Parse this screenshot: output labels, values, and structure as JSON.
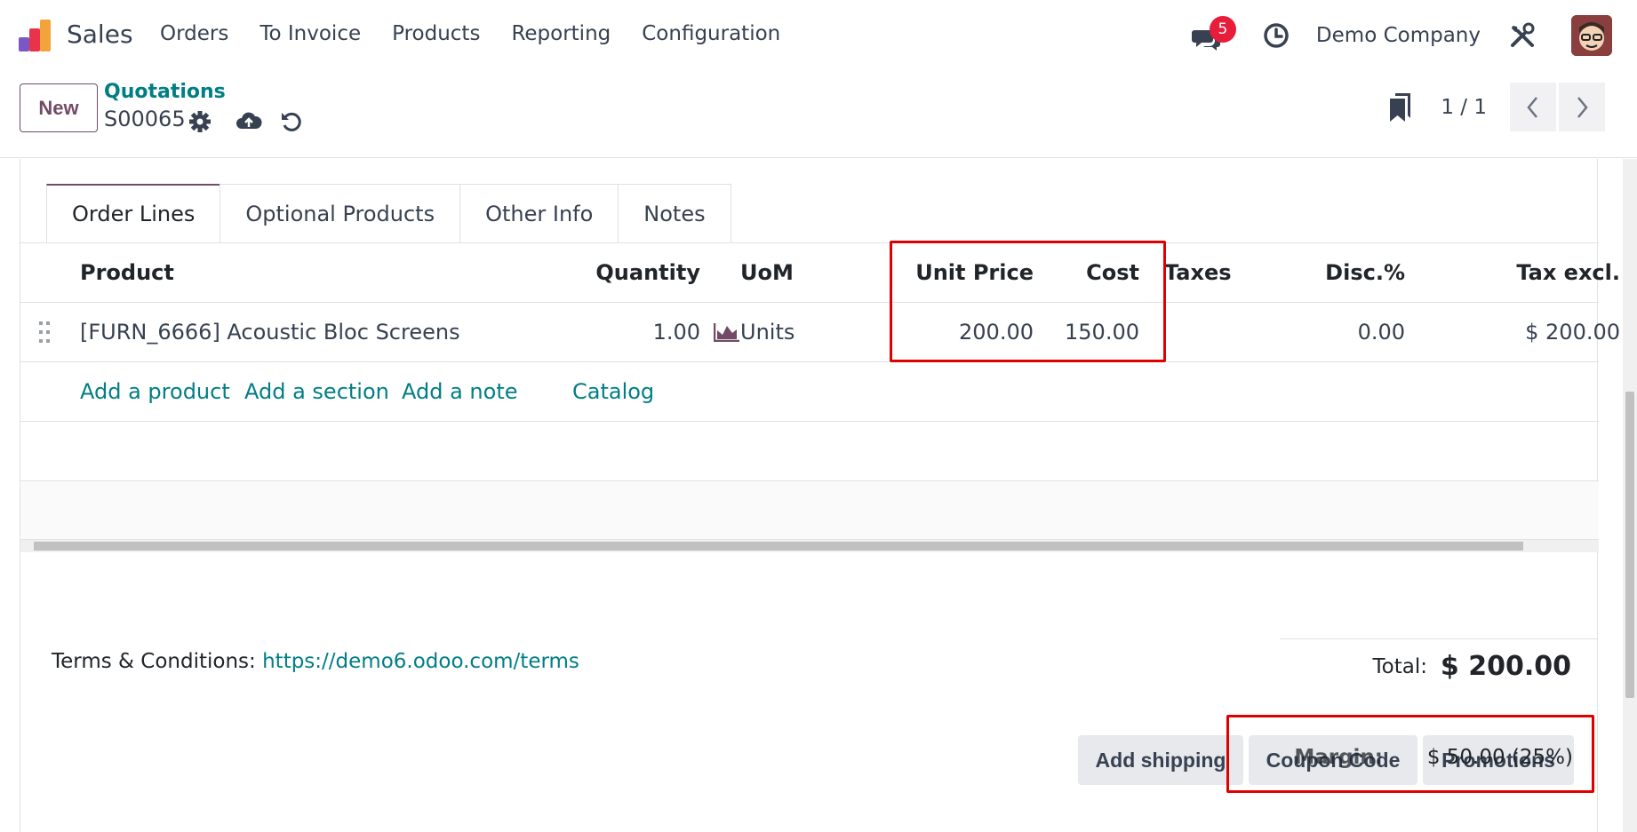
{
  "navbar": {
    "app_name": "Sales",
    "menu": [
      "Orders",
      "To Invoice",
      "Products",
      "Reporting",
      "Configuration"
    ],
    "chat_count": "5",
    "company": "Demo Company",
    "brand_colors": [
      "#e8334a",
      "#f2a33a",
      "#7b57c6"
    ]
  },
  "control": {
    "new_label": "New",
    "breadcrumb": "Quotations",
    "record_name": "S00065",
    "pager": "1 / 1"
  },
  "tabs": [
    "Order Lines",
    "Optional Products",
    "Other Info",
    "Notes"
  ],
  "table": {
    "headers": {
      "product": "Product",
      "quantity": "Quantity",
      "uom": "UoM",
      "unit_price": "Unit Price",
      "cost": "Cost",
      "taxes": "Taxes",
      "discount": "Disc.%",
      "tax_excl": "Tax excl."
    },
    "rows": [
      {
        "product": "[FURN_6666] Acoustic Bloc Screens",
        "quantity": "1.00",
        "uom": "Units",
        "unit_price": "200.00",
        "cost": "150.00",
        "taxes": "",
        "discount": "0.00",
        "tax_excl": "$ 200.00"
      }
    ],
    "add_links": {
      "add_product": "Add a product",
      "add_section": "Add a section",
      "add_note": "Add a note",
      "catalog": "Catalog"
    }
  },
  "actions": {
    "add_shipping": "Add shipping",
    "coupon_code": "Coupon Code",
    "promotions": "Promotions"
  },
  "terms": {
    "label": "Terms & Conditions:",
    "url": "https://demo6.odoo.com/terms"
  },
  "totals": {
    "total_label": "Total:",
    "total_value": "$ 200.00",
    "margin_label": "Margin:",
    "margin_value": "$ 50.00 (25%)"
  },
  "colors": {
    "primary": "#714b67",
    "link": "#017e84",
    "highlight": "#e00000",
    "badge": "#e81d3a"
  }
}
